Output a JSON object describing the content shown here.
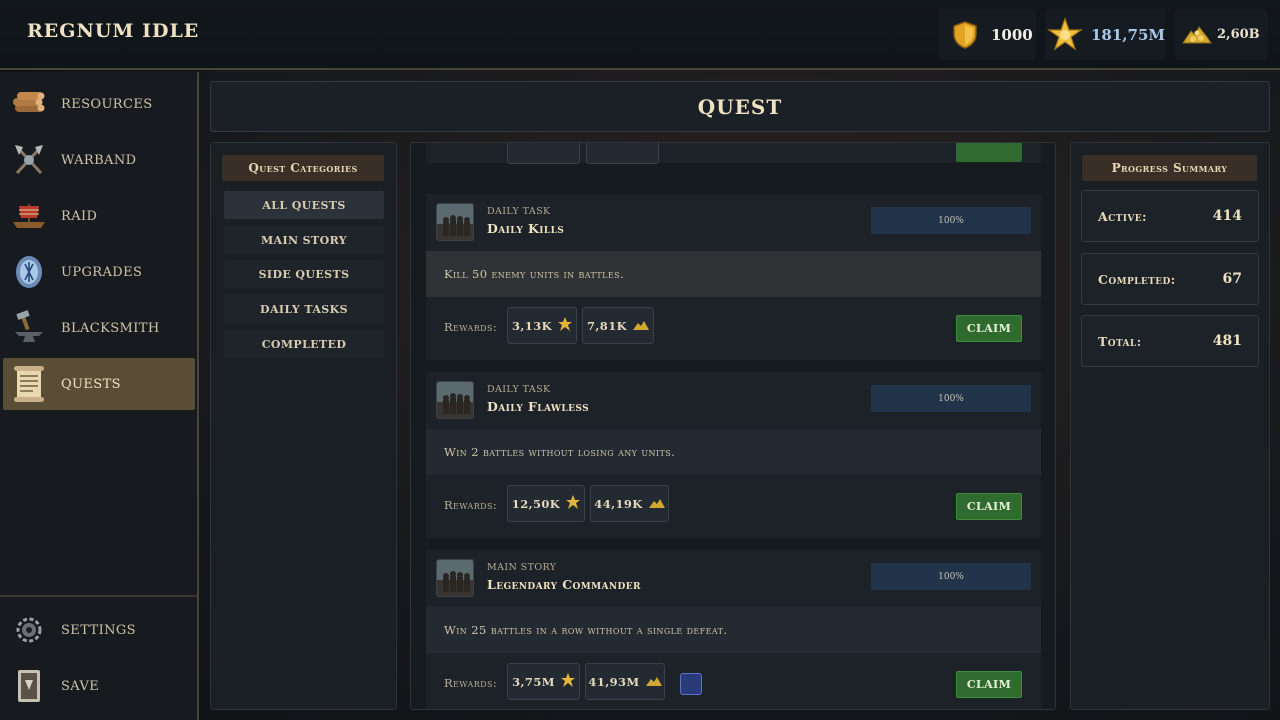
{
  "app": {
    "title": "REGNUM IDLE"
  },
  "resources": [
    {
      "icon": "shield-icon",
      "value": "1000",
      "color": "#f2efe6"
    },
    {
      "icon": "gold-star-icon",
      "value": "181,75M",
      "color": "#a8c8e8"
    },
    {
      "icon": "gold-pile-icon",
      "value": "2,60B",
      "color": "#e8e0cc"
    }
  ],
  "sidebar": {
    "items": [
      {
        "label": "RESOURCES",
        "icon": "logs-icon"
      },
      {
        "label": "WARBAND",
        "icon": "crossed-axes-icon"
      },
      {
        "label": "RAID",
        "icon": "longship-icon"
      },
      {
        "label": "UPGRADES",
        "icon": "rune-stone-icon"
      },
      {
        "label": "BLACKSMITH",
        "icon": "anvil-hammer-icon"
      },
      {
        "label": "QUESTS",
        "icon": "scroll-icon",
        "active": true
      }
    ],
    "footer": [
      {
        "label": "SETTINGS",
        "icon": "gear-icon"
      },
      {
        "label": "SAVE",
        "icon": "book-icon"
      }
    ]
  },
  "main": {
    "title": "QUEST"
  },
  "categories": {
    "title": "Quest Categories",
    "items": [
      {
        "label": "ALL QUESTS",
        "active": true
      },
      {
        "label": "MAIN STORY"
      },
      {
        "label": "SIDE QUESTS"
      },
      {
        "label": "DAILY TASKS"
      },
      {
        "label": "COMPLETED"
      }
    ]
  },
  "quests": [
    {
      "type": "DAILY TASK",
      "name": "Daily Kills",
      "progress_label": "100%",
      "progress": 1.0,
      "description": "Kill 50 enemy units in battles.",
      "rewards_label": "Rewards:",
      "rewards": [
        {
          "value": "3,13K",
          "icon": "gold-coin-icon"
        },
        {
          "value": "7,81K",
          "icon": "gold-pile-icon"
        }
      ],
      "claim_label": "CLAIM"
    },
    {
      "type": "DAILY TASK",
      "name": "Daily Flawless",
      "progress_label": "100%",
      "progress": 1.0,
      "description": "Win 2 battles without losing any units.",
      "rewards_label": "Rewards:",
      "rewards": [
        {
          "value": "12,50K",
          "icon": "gold-coin-icon"
        },
        {
          "value": "44,19K",
          "icon": "gold-pile-icon"
        }
      ],
      "claim_label": "CLAIM"
    },
    {
      "type": "MAIN STORY",
      "name": "Legendary Commander",
      "progress_label": "100%",
      "progress": 1.0,
      "description": "Win 25 battles in a row without a single defeat.",
      "rewards_label": "Rewards:",
      "rewards": [
        {
          "value": "3,75M",
          "icon": "gold-coin-icon"
        },
        {
          "value": "41,93M",
          "icon": "gold-pile-icon"
        }
      ],
      "extra_reward_icon": "rune-item-icon",
      "claim_label": "CLAIM"
    }
  ],
  "summary": {
    "title": "Progress Summary",
    "active_label": "Active:",
    "active_value": "414",
    "completed_label": "Completed:",
    "completed_value": "67",
    "total_label": "Total:",
    "total_value": "481"
  }
}
